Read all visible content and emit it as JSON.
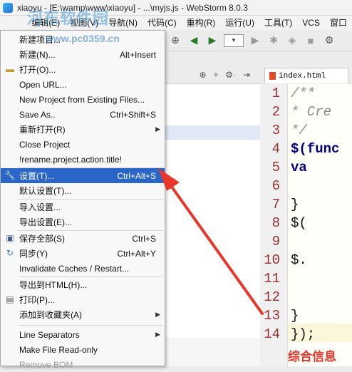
{
  "window": {
    "title": "xiaoyu - [E:\\wamp\\www\\xiaoyu] - ...\\myjs.js - WebStorm 8.0.3"
  },
  "menubar": {
    "items": [
      "编辑(E)",
      "视图(V)",
      "导航(N)",
      "代码(C)",
      "重构(R)",
      "运行(U)",
      "工具(T)",
      "VCS",
      "窗口"
    ]
  },
  "file_menu": {
    "items": [
      {
        "label": "新建项目...",
        "shortcut": ""
      },
      {
        "label": "新建(N)...",
        "shortcut": "Alt+Insert"
      },
      {
        "label": "打开(O)...",
        "shortcut": ""
      },
      {
        "label": "Open URL...",
        "shortcut": ""
      },
      {
        "label": "New Project from Existing Files...",
        "shortcut": ""
      },
      {
        "label": "Save As..",
        "shortcut": "Ctrl+Shift+S"
      },
      {
        "label": "重新打开(R)",
        "shortcut": ""
      },
      {
        "label": "Close Project",
        "shortcut": ""
      },
      {
        "label": "!rename.project.action.title!",
        "shortcut": ""
      },
      {
        "label": "设置(T)...",
        "shortcut": "Ctrl+Alt+S"
      },
      {
        "label": "默认设置(T)...",
        "shortcut": ""
      },
      {
        "label": "导入设置...",
        "shortcut": ""
      },
      {
        "label": "导出设置(E)...",
        "shortcut": ""
      },
      {
        "label": "保存全部(S)",
        "shortcut": "Ctrl+S"
      },
      {
        "label": "同步(Y)",
        "shortcut": "Ctrl+Alt+Y"
      },
      {
        "label": "Invalidate Caches / Restart...",
        "shortcut": ""
      },
      {
        "label": "导出到HTML(H)...",
        "shortcut": ""
      },
      {
        "label": "打印(P)...",
        "shortcut": ""
      },
      {
        "label": "添加到收藏夹(A)",
        "shortcut": ""
      },
      {
        "label": "Line Separators",
        "shortcut": ""
      },
      {
        "label": "Make File Read-only",
        "shortcut": ""
      },
      {
        "label": "Remove BOM",
        "shortcut": ""
      }
    ],
    "highlighted_index": 9,
    "highlight_color": "#2a66c7"
  },
  "editor": {
    "tab_label": "index.html",
    "line_numbers": [
      "1",
      "2",
      "3",
      "4",
      "5",
      "6",
      "7",
      "8",
      "9",
      "10",
      "11",
      "12",
      "13",
      "14"
    ],
    "code_lines": [
      "/**",
      " * Cre",
      " */",
      "$(func",
      "    va",
      "",
      "    }",
      "    $(",
      "",
      "    $.",
      "",
      "",
      "    }",
      "});"
    ]
  },
  "watermarks": {
    "site_name": "河东软件园",
    "site_url": "www.pc0359.cn",
    "corner_text": "综合信息"
  },
  "annotation": {
    "arrow_color": "#e8362b"
  }
}
